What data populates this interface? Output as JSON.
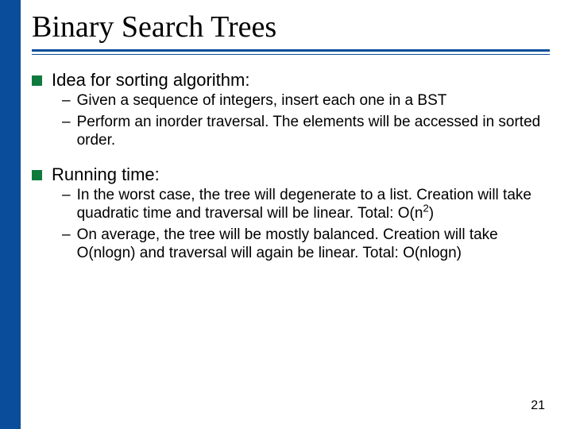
{
  "title": "Binary Search Trees",
  "bullets": {
    "b1": {
      "heading": "Idea for sorting algorithm:",
      "sub": {
        "s1": "Given a sequence of integers, insert each one in a BST",
        "s2": "Perform an inorder traversal. The elements will be accessed in sorted order."
      }
    },
    "b2": {
      "heading": "Running time:",
      "sub": {
        "s1_a": "In the worst case, the tree will degenerate to a list. Creation will take quadratic time and traversal will be linear. Total: O(n",
        "s1_sup": "2",
        "s1_b": ")",
        "s2": "On average, the tree will be mostly balanced. Creation will take O(nlogn) and traversal will again be linear. Total: O(nlogn)"
      }
    }
  },
  "dash": "–",
  "page_number": "21"
}
